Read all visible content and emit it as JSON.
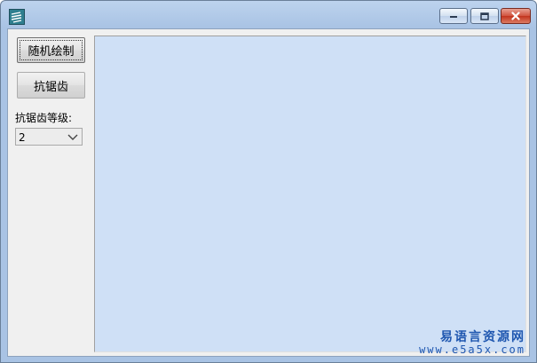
{
  "window": {
    "icon": "app-icon",
    "controls": {
      "minimize_icon": "minimize-icon",
      "maximize_icon": "maximize-icon",
      "close_icon": "close-icon"
    }
  },
  "sidebar": {
    "random_draw_label": "随机绘制",
    "antialias_label": "抗锯齿",
    "level_label": "抗锯齿等级:",
    "level_value": "2"
  },
  "watermark": {
    "title": "易语言资源网",
    "url": "www.e5a5x.com"
  },
  "colors": {
    "canvas_background": "#cfe0f6",
    "titlebar": "#a9c3e4",
    "close_button": "#c2331d",
    "watermark_text": "#1f57b0"
  }
}
